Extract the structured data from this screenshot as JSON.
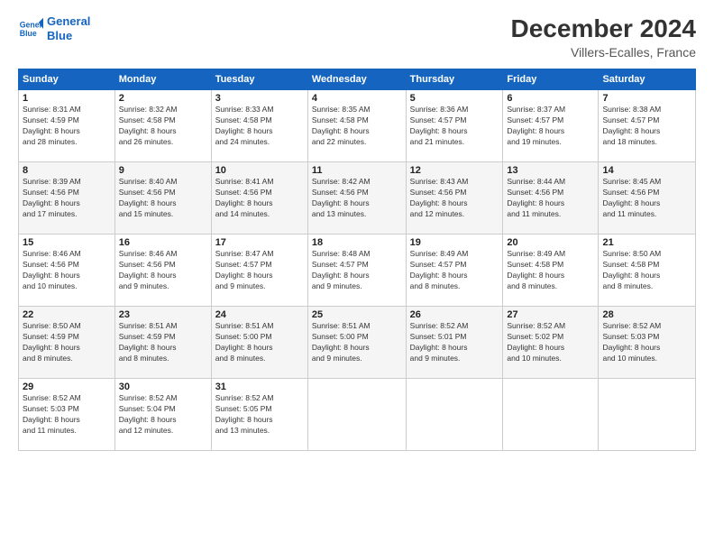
{
  "logo": {
    "line1": "General",
    "line2": "Blue"
  },
  "title": "December 2024",
  "subtitle": "Villers-Ecalles, France",
  "days_of_week": [
    "Sunday",
    "Monday",
    "Tuesday",
    "Wednesday",
    "Thursday",
    "Friday",
    "Saturday"
  ],
  "weeks": [
    [
      {
        "day": "1",
        "sunrise": "8:31 AM",
        "sunset": "4:59 PM",
        "daylight": "8 hours and 28 minutes."
      },
      {
        "day": "2",
        "sunrise": "8:32 AM",
        "sunset": "4:58 PM",
        "daylight": "8 hours and 26 minutes."
      },
      {
        "day": "3",
        "sunrise": "8:33 AM",
        "sunset": "4:58 PM",
        "daylight": "8 hours and 24 minutes."
      },
      {
        "day": "4",
        "sunrise": "8:35 AM",
        "sunset": "4:58 PM",
        "daylight": "8 hours and 22 minutes."
      },
      {
        "day": "5",
        "sunrise": "8:36 AM",
        "sunset": "4:57 PM",
        "daylight": "8 hours and 21 minutes."
      },
      {
        "day": "6",
        "sunrise": "8:37 AM",
        "sunset": "4:57 PM",
        "daylight": "8 hours and 19 minutes."
      },
      {
        "day": "7",
        "sunrise": "8:38 AM",
        "sunset": "4:57 PM",
        "daylight": "8 hours and 18 minutes."
      }
    ],
    [
      {
        "day": "8",
        "sunrise": "8:39 AM",
        "sunset": "4:56 PM",
        "daylight": "8 hours and 17 minutes."
      },
      {
        "day": "9",
        "sunrise": "8:40 AM",
        "sunset": "4:56 PM",
        "daylight": "8 hours and 15 minutes."
      },
      {
        "day": "10",
        "sunrise": "8:41 AM",
        "sunset": "4:56 PM",
        "daylight": "8 hours and 14 minutes."
      },
      {
        "day": "11",
        "sunrise": "8:42 AM",
        "sunset": "4:56 PM",
        "daylight": "8 hours and 13 minutes."
      },
      {
        "day": "12",
        "sunrise": "8:43 AM",
        "sunset": "4:56 PM",
        "daylight": "8 hours and 12 minutes."
      },
      {
        "day": "13",
        "sunrise": "8:44 AM",
        "sunset": "4:56 PM",
        "daylight": "8 hours and 11 minutes."
      },
      {
        "day": "14",
        "sunrise": "8:45 AM",
        "sunset": "4:56 PM",
        "daylight": "8 hours and 11 minutes."
      }
    ],
    [
      {
        "day": "15",
        "sunrise": "8:46 AM",
        "sunset": "4:56 PM",
        "daylight": "8 hours and 10 minutes."
      },
      {
        "day": "16",
        "sunrise": "8:46 AM",
        "sunset": "4:56 PM",
        "daylight": "8 hours and 9 minutes."
      },
      {
        "day": "17",
        "sunrise": "8:47 AM",
        "sunset": "4:57 PM",
        "daylight": "8 hours and 9 minutes."
      },
      {
        "day": "18",
        "sunrise": "8:48 AM",
        "sunset": "4:57 PM",
        "daylight": "8 hours and 9 minutes."
      },
      {
        "day": "19",
        "sunrise": "8:49 AM",
        "sunset": "4:57 PM",
        "daylight": "8 hours and 8 minutes."
      },
      {
        "day": "20",
        "sunrise": "8:49 AM",
        "sunset": "4:58 PM",
        "daylight": "8 hours and 8 minutes."
      },
      {
        "day": "21",
        "sunrise": "8:50 AM",
        "sunset": "4:58 PM",
        "daylight": "8 hours and 8 minutes."
      }
    ],
    [
      {
        "day": "22",
        "sunrise": "8:50 AM",
        "sunset": "4:59 PM",
        "daylight": "8 hours and 8 minutes."
      },
      {
        "day": "23",
        "sunrise": "8:51 AM",
        "sunset": "4:59 PM",
        "daylight": "8 hours and 8 minutes."
      },
      {
        "day": "24",
        "sunrise": "8:51 AM",
        "sunset": "5:00 PM",
        "daylight": "8 hours and 8 minutes."
      },
      {
        "day": "25",
        "sunrise": "8:51 AM",
        "sunset": "5:00 PM",
        "daylight": "8 hours and 9 minutes."
      },
      {
        "day": "26",
        "sunrise": "8:52 AM",
        "sunset": "5:01 PM",
        "daylight": "8 hours and 9 minutes."
      },
      {
        "day": "27",
        "sunrise": "8:52 AM",
        "sunset": "5:02 PM",
        "daylight": "8 hours and 10 minutes."
      },
      {
        "day": "28",
        "sunrise": "8:52 AM",
        "sunset": "5:03 PM",
        "daylight": "8 hours and 10 minutes."
      }
    ],
    [
      {
        "day": "29",
        "sunrise": "8:52 AM",
        "sunset": "5:03 PM",
        "daylight": "8 hours and 11 minutes."
      },
      {
        "day": "30",
        "sunrise": "8:52 AM",
        "sunset": "5:04 PM",
        "daylight": "8 hours and 12 minutes."
      },
      {
        "day": "31",
        "sunrise": "8:52 AM",
        "sunset": "5:05 PM",
        "daylight": "8 hours and 13 minutes."
      },
      null,
      null,
      null,
      null
    ]
  ],
  "labels": {
    "sunrise": "Sunrise:",
    "sunset": "Sunset:",
    "daylight": "Daylight:"
  }
}
